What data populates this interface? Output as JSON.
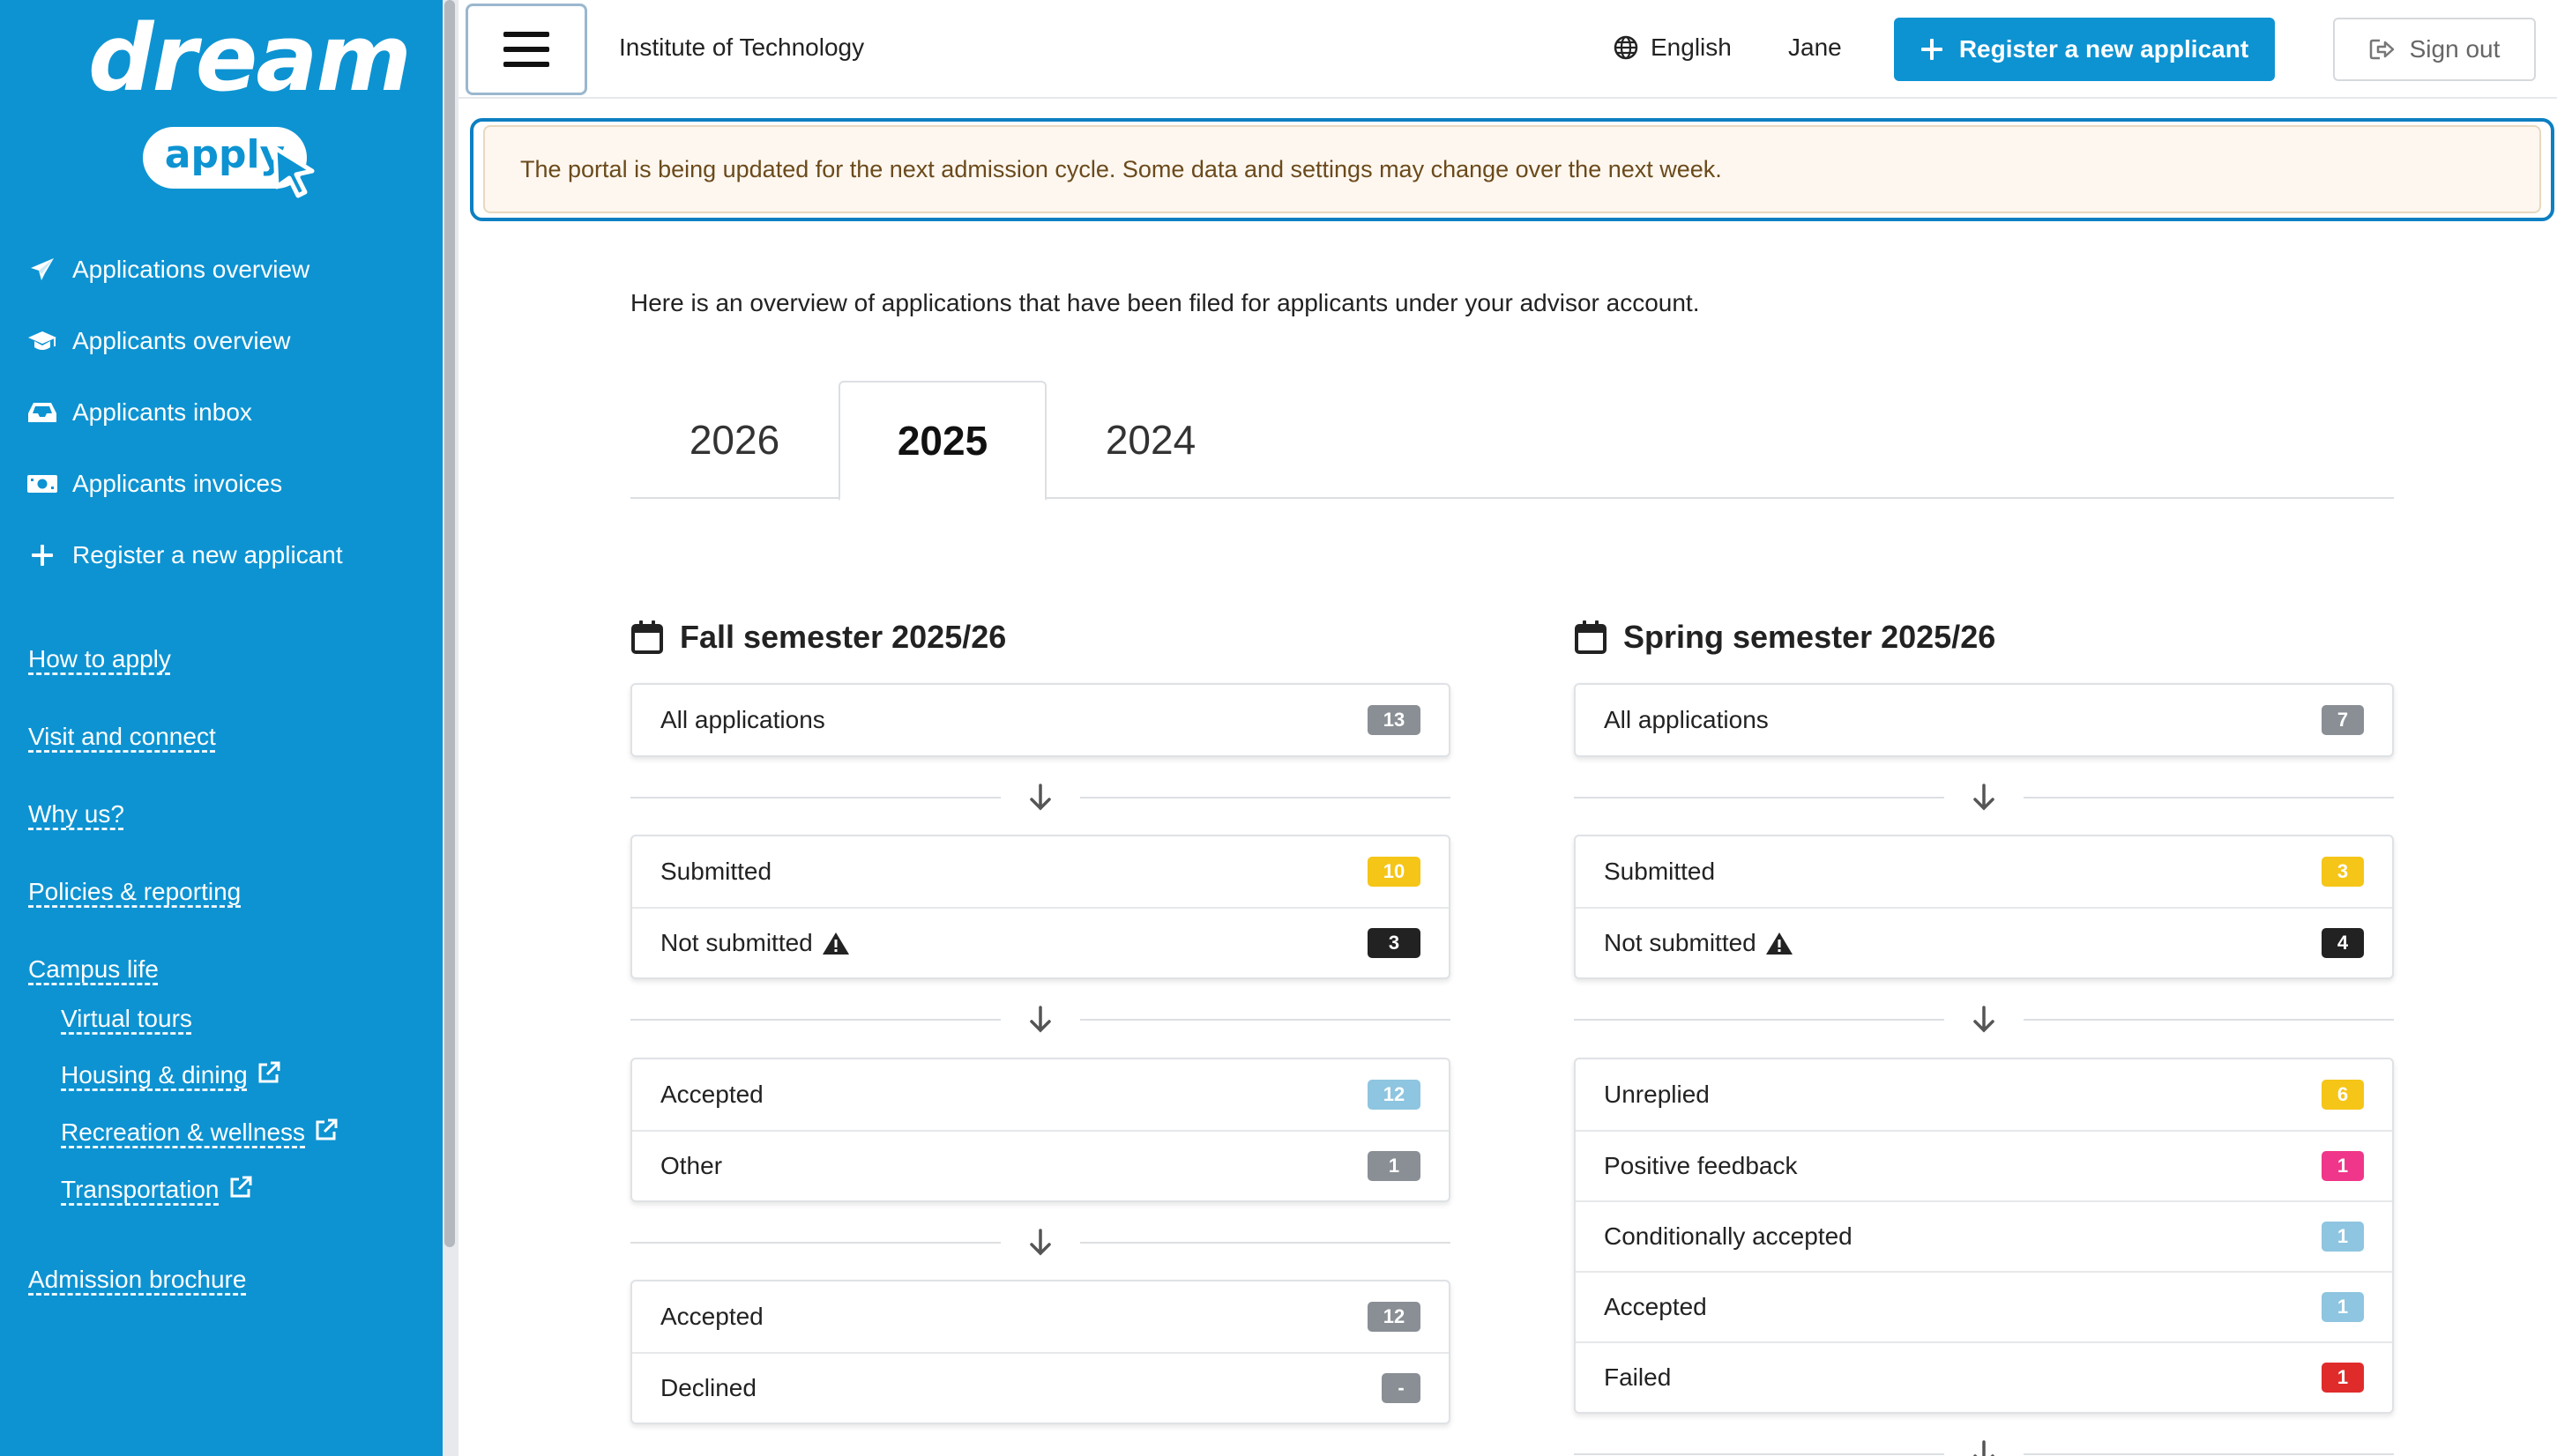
{
  "brand": {
    "word": "dream",
    "pill": "apply"
  },
  "sidebar": {
    "nav": [
      {
        "label": "Applications overview",
        "icon": "paper-plane-icon"
      },
      {
        "label": "Applicants overview",
        "icon": "graduation-cap-icon"
      },
      {
        "label": "Applicants inbox",
        "icon": "inbox-icon"
      },
      {
        "label": "Applicants invoices",
        "icon": "money-bill-icon"
      },
      {
        "label": "Register a new applicant",
        "icon": "plus-icon"
      }
    ],
    "links": {
      "how_to_apply": "How to apply",
      "visit": "Visit and connect",
      "why_us": "Why us?",
      "policies": "Policies & reporting",
      "campus_life": "Campus life",
      "virtual_tours": "Virtual tours",
      "housing": "Housing & dining",
      "recreation": "Recreation & wellness",
      "transportation": "Transportation",
      "brochure": "Admission brochure"
    }
  },
  "header": {
    "institute": "Institute of Technology",
    "language": "English",
    "user": "Jane",
    "register_label": "Register a new applicant",
    "signout_label": "Sign out"
  },
  "notice": "The portal is being updated for the next admission cycle. Some data and settings may change over the next week.",
  "intro": "Here is an overview of applications that have been filed for applicants under your advisor account.",
  "tabs": [
    {
      "label": "2026",
      "active": false
    },
    {
      "label": "2025",
      "active": true
    },
    {
      "label": "2024",
      "active": false
    }
  ],
  "colors": {
    "brand": "#0d93d2",
    "badge_gray": "#8a8f95",
    "badge_yellow": "#f5c518",
    "badge_dark": "#222222",
    "badge_lightblue": "#8ec5e0",
    "badge_pink": "#f0368a",
    "badge_red": "#e02b2b"
  },
  "fall": {
    "title": "Fall semester 2025/26",
    "all": {
      "label": "All applications",
      "count": "13"
    },
    "submitted": {
      "label": "Submitted",
      "count": "10"
    },
    "not_submitted": {
      "label": "Not submitted",
      "count": "3"
    },
    "accepted": {
      "label": "Accepted",
      "count": "12"
    },
    "other": {
      "label": "Other",
      "count": "1"
    },
    "accepted2": {
      "label": "Accepted",
      "count": "12"
    },
    "declined": {
      "label": "Declined",
      "count": "-"
    }
  },
  "spring": {
    "title": "Spring semester 2025/26",
    "all": {
      "label": "All applications",
      "count": "7"
    },
    "submitted": {
      "label": "Submitted",
      "count": "3"
    },
    "not_submitted": {
      "label": "Not submitted",
      "count": "4"
    },
    "unreplied": {
      "label": "Unreplied",
      "count": "6"
    },
    "positive": {
      "label": "Positive feedback",
      "count": "1"
    },
    "conditional": {
      "label": "Conditionally accepted",
      "count": "1"
    },
    "accepted": {
      "label": "Accepted",
      "count": "1"
    },
    "failed": {
      "label": "Failed",
      "count": "1"
    }
  }
}
